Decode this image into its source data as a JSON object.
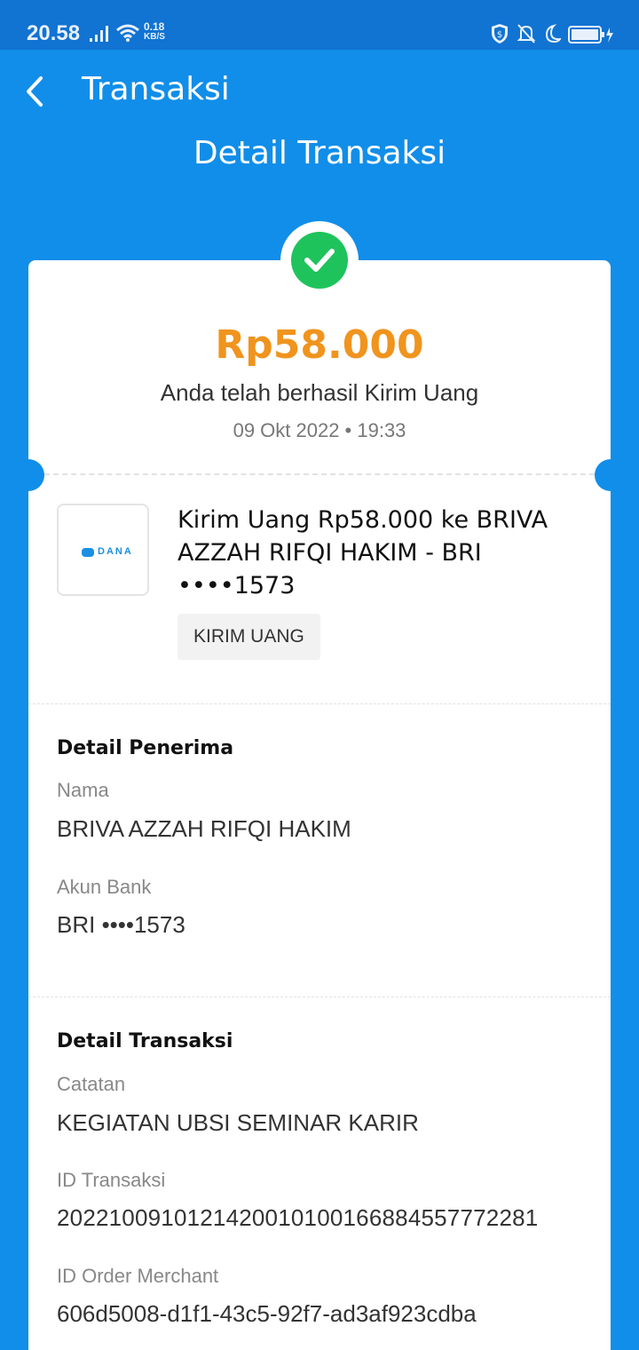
{
  "status_bar": {
    "time": "20.58",
    "net_speed_value": "0.18",
    "net_speed_unit": "KB/S"
  },
  "header": {
    "back_icon": "chevron-left-icon",
    "title": "Transaksi"
  },
  "page_title": "Detail Transaksi",
  "summary": {
    "status_icon": "check-circle-icon",
    "amount": "Rp58.000",
    "message": "Anda telah berhasil Kirim Uang",
    "datetime": "09 Okt 2022 • 19:33"
  },
  "transaction": {
    "merchant_logo_text": "DANA",
    "title": "Kirim Uang Rp58.000 ke BRIVA AZZAH RIFQI HAKIM - BRI ••••1573",
    "tag": "KIRIM UANG"
  },
  "recipient": {
    "section_title": "Detail Penerima",
    "name_label": "Nama",
    "name_value": "BRIVA AZZAH RIFQI HAKIM",
    "bank_label": "Akun Bank",
    "bank_value": "BRI ••••1573"
  },
  "details": {
    "section_title": "Detail Transaksi",
    "note_label": "Catatan",
    "note_value": "KEGIATAN UBSI SEMINAR KARIR",
    "tx_id_label": "ID Transaksi",
    "tx_id_value": "2022100910121420010100166884557772281",
    "order_id_label": "ID Order Merchant",
    "order_id_value": "606d5008-d1f1-43c5-92f7-ad3af923cdba"
  },
  "colors": {
    "primary": "#118ee9",
    "status_bar": "#1173d2",
    "amount": "#f0941e",
    "success": "#1fc35c"
  }
}
